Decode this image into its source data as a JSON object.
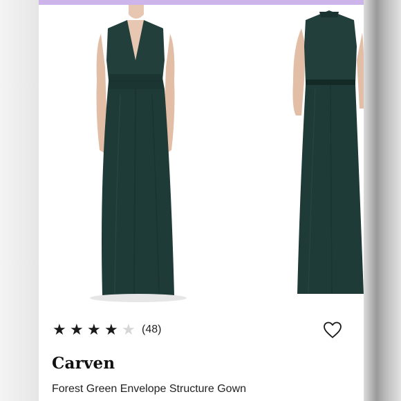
{
  "product": {
    "brand": "Carven",
    "name": "Forest Green Envelope Structure Gown",
    "rating": {
      "stars_filled": 4,
      "stars_total": 5,
      "count": "(48)"
    }
  },
  "colors": {
    "accent_strip": "#cdb4ea",
    "dress": "#1f3b38",
    "star_filled": "#1a1a1a",
    "star_empty": "#d6d6d6"
  },
  "icons": {
    "star": "star-icon",
    "favorite": "heart-outline-icon"
  }
}
